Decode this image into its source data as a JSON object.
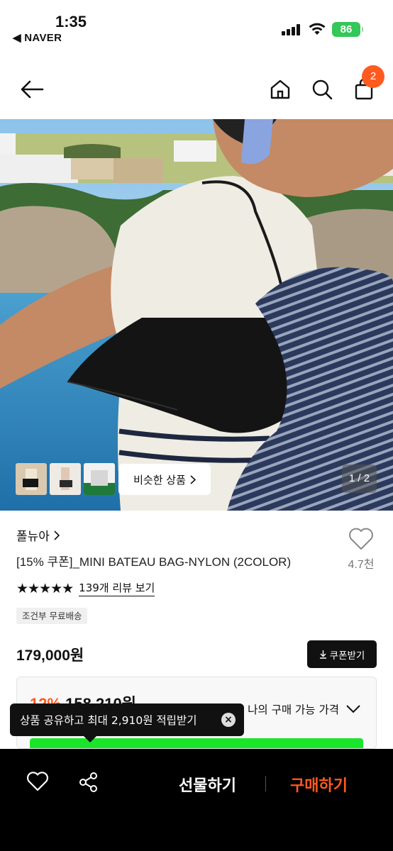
{
  "status_bar": {
    "time": "1:35",
    "back_app": "◀ NAVER",
    "battery": "86"
  },
  "header": {
    "cart_count": "2",
    "icons": [
      "back-arrow-icon",
      "home-icon",
      "search-icon",
      "cart-icon"
    ]
  },
  "hero": {
    "similar_label": "비슷한 상품",
    "pager": "1 / 2"
  },
  "product": {
    "brand": "폴뉴아",
    "title": "[15% 쿠폰]_MINI BATEAU BAG-NYLON (2COLOR)",
    "like_count": "4.7천",
    "stars": "★★★★★",
    "review_link": "139개 리뷰 보기",
    "shipping": "조건부 무료배송",
    "price": "179,000원",
    "coupon_label": "쿠폰받기"
  },
  "price_box": {
    "discount_pct": "12%",
    "discount_price": "158,210원",
    "my_price_label": "나의 구매 가능 가격"
  },
  "tooltip": {
    "text": "상품 공유하고 최대 2,910원 적립받기"
  },
  "bottom_bar": {
    "gift_label": "선물하기",
    "buy_label": "구매하기"
  },
  "colors": {
    "accent": "#ff5a1f",
    "battery": "#34c759",
    "promo_green": "#19e62b"
  }
}
